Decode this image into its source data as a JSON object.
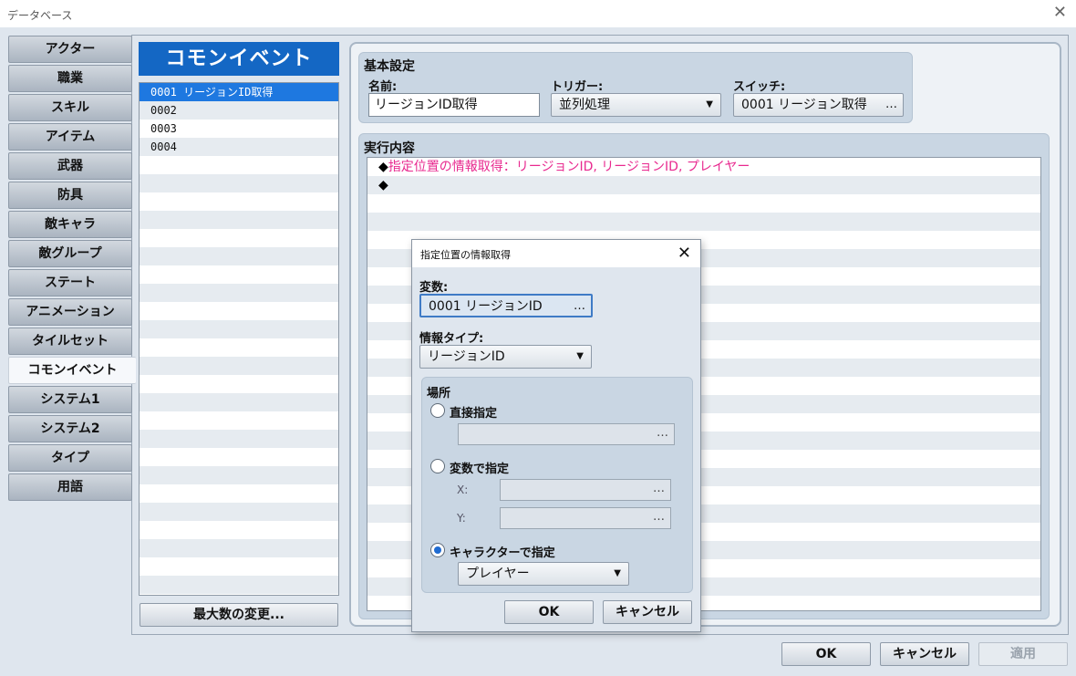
{
  "window": {
    "title": "データベース",
    "close_glyph": "✕"
  },
  "categories": [
    {
      "label": "アクター"
    },
    {
      "label": "職業"
    },
    {
      "label": "スキル"
    },
    {
      "label": "アイテム"
    },
    {
      "label": "武器"
    },
    {
      "label": "防具"
    },
    {
      "label": "敵キャラ"
    },
    {
      "label": "敵グループ"
    },
    {
      "label": "ステート"
    },
    {
      "label": "アニメーション"
    },
    {
      "label": "タイルセット"
    },
    {
      "label": "コモンイベント",
      "active": true
    },
    {
      "label": "システム1"
    },
    {
      "label": "システム2"
    },
    {
      "label": "タイプ"
    },
    {
      "label": "用語"
    }
  ],
  "list": {
    "header": "コモンイベント",
    "items": [
      {
        "text": "0001 リージョンID取得",
        "selected": true
      },
      {
        "text": "0002"
      },
      {
        "text": "0003"
      },
      {
        "text": "0004"
      }
    ],
    "max_button": "最大数の変更..."
  },
  "basic": {
    "section_label": "基本設定",
    "name_label": "名前:",
    "name_value": "リージョンID取得",
    "trigger_label": "トリガー:",
    "trigger_value": "並列処理",
    "switch_label": "スイッチ:",
    "switch_value": "0001 リージョン取得"
  },
  "exec": {
    "section_label": "実行内容",
    "commands": [
      {
        "marker": "◆",
        "text": "指定位置の情報取得：リージョンID, リージョンID, プレイヤー"
      },
      {
        "marker": "◆",
        "text": ""
      }
    ]
  },
  "footer": {
    "ok": "OK",
    "cancel": "キャンセル",
    "apply": "適用"
  },
  "dialog": {
    "title": "指定位置の情報取得",
    "close_glyph": "✕",
    "variable_label": "変数:",
    "variable_value": "0001 リージョンID",
    "info_type_label": "情報タイプ:",
    "info_type_value": "リージョンID",
    "place_label": "場所",
    "direct_label": "直接指定",
    "by_var_label": "変数で指定",
    "x_label": "X:",
    "y_label": "Y:",
    "by_char_label": "キャラクターで指定",
    "character_value": "プレイヤー",
    "ok": "OK",
    "cancel": "キャンセル",
    "selected_option": "キャラクターで指定"
  },
  "icons": {
    "dropdown_arrow": "▼",
    "ellipsis": "…"
  },
  "colors": {
    "header_blue": "#1467c4",
    "selection_blue": "#1e78e0",
    "command_pink": "#e8298f"
  }
}
